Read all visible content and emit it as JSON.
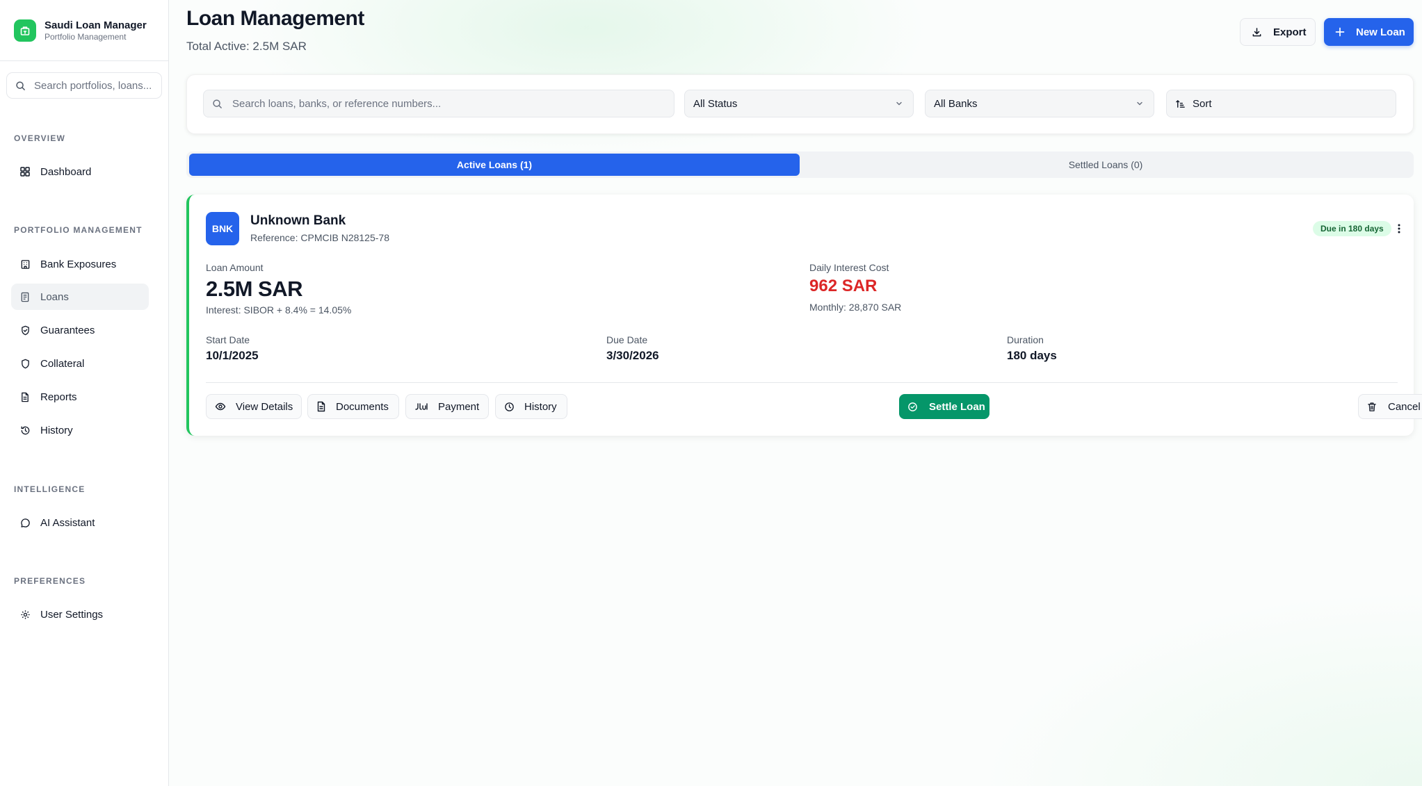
{
  "sidebar": {
    "brand": {
      "title": "Saudi Loan Manager",
      "subtitle": "Portfolio Management",
      "icon": "building-icon"
    },
    "search": {
      "placeholder": "Search portfolios, loans..."
    },
    "sections": {
      "overview": "OVERVIEW",
      "portfolio": "PORTFOLIO MANAGEMENT",
      "intelligence": "INTELLIGENCE",
      "preferences": "PREFERENCES"
    },
    "items": {
      "dashboard": "Dashboard",
      "bank_exposures": "Bank Exposures",
      "loans": "Loans",
      "guarantees": "Guarantees",
      "collateral": "Collateral",
      "reports": "Reports",
      "history": "History",
      "ai_assistant": "AI Assistant",
      "user_settings": "User Settings"
    },
    "active_item": "Loans"
  },
  "header": {
    "title": "Loan Management",
    "subtitle": "Total Active: 2.5M SAR",
    "export_label": "Export",
    "new_loan_label": "New Loan"
  },
  "filters": {
    "search_placeholder": "Search loans, banks, or reference numbers...",
    "status_value": "All Status",
    "banks_value": "All Banks",
    "sort_label": "Sort"
  },
  "tabs": {
    "active": "Active Loans (1)",
    "settled": "Settled Loans (0)"
  },
  "loan": {
    "bank_code": "BNK",
    "bank_name": "Unknown Bank",
    "reference": "Reference: CPMCIB N28125-78",
    "due_badge": "Due in 180 days",
    "amount_label": "Loan Amount",
    "amount": "2.5M SAR",
    "interest": "Interest: SIBOR + 8.4% = 14.05%",
    "daily_label": "Daily Interest Cost",
    "daily_value": "962 SAR",
    "monthly": "Monthly: 28,870 SAR",
    "start_label": "Start Date",
    "start_value": "10/1/2025",
    "due_label": "Due Date",
    "due_value": "3/30/2026",
    "duration_label": "Duration",
    "duration_value": "180 days",
    "actions": {
      "view": "View Details",
      "documents": "Documents",
      "payment": "Payment",
      "history": "History",
      "settle": "Settle Loan",
      "cancel": "Cancel"
    }
  },
  "colors": {
    "primary": "#2563eb",
    "success": "#059669",
    "brand": "#22c55e",
    "danger": "#dc2626"
  }
}
